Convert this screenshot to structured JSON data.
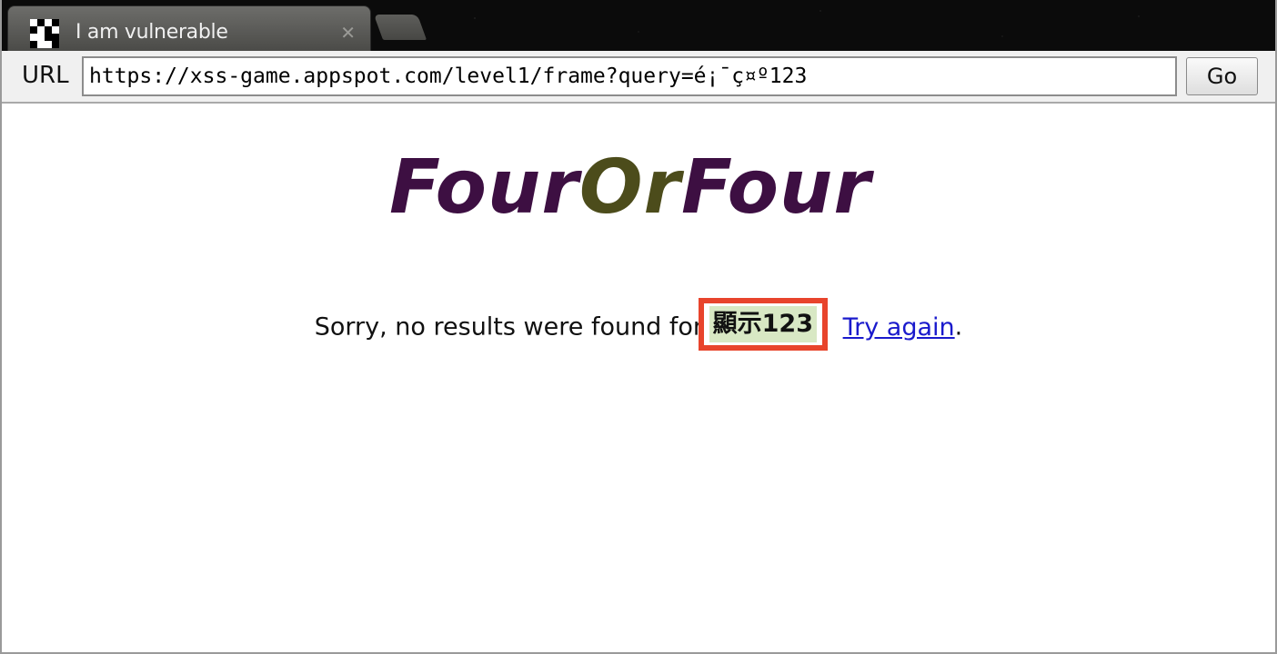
{
  "tab": {
    "title": "I am vulnerable",
    "close_glyph": "✕"
  },
  "urlbar": {
    "label": "URL",
    "value": "https://xss-game.appspot.com/level1/frame?query=é¡¯ç¤º123",
    "go_label": "Go"
  },
  "logo": {
    "part1": "Four",
    "part2": "Or",
    "part3": "Four",
    "colors": {
      "primary": "#3d0f42",
      "secondary": "#4c4c1b"
    }
  },
  "message": {
    "prefix": "Sorry, no results were found for",
    "query": "顯示123",
    "link_label": "Try again",
    "suffix": "."
  },
  "colors": {
    "highlight_border": "#e8442c",
    "query_bg": "#d8e8c4",
    "link": "#1a1acc"
  }
}
